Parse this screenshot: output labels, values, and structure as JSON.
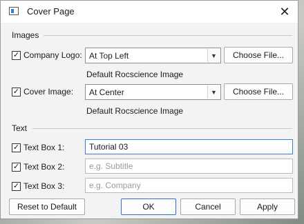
{
  "window": {
    "title": "Cover Page",
    "close_glyph": "✕"
  },
  "images_group": {
    "label": "Images",
    "company_logo": {
      "label": "Company Logo:",
      "checked": true,
      "position": "At Top Left",
      "choose_label": "Choose File...",
      "caption": "Default Rocscience Image"
    },
    "cover_image": {
      "label": "Cover Image:",
      "checked": true,
      "position": "At Center",
      "choose_label": "Choose File...",
      "caption": "Default Rocscience Image"
    }
  },
  "text_group": {
    "label": "Text",
    "box1": {
      "label": "Text Box 1:",
      "checked": true,
      "value": "Tutorial 03",
      "placeholder": ""
    },
    "box2": {
      "label": "Text Box 2:",
      "checked": true,
      "value": "",
      "placeholder": "e.g. Subtitle"
    },
    "box3": {
      "label": "Text Box 3:",
      "checked": true,
      "value": "",
      "placeholder": "e.g. Company"
    }
  },
  "footer": {
    "reset_label": "Reset to Default",
    "ok_label": "OK",
    "cancel_label": "Cancel",
    "apply_label": "Apply"
  },
  "glyphs": {
    "check": "✓",
    "dropdown_arrow": "▼"
  },
  "colors": {
    "accent": "#3a7bd5",
    "primary_border": "#2f6fd0"
  }
}
